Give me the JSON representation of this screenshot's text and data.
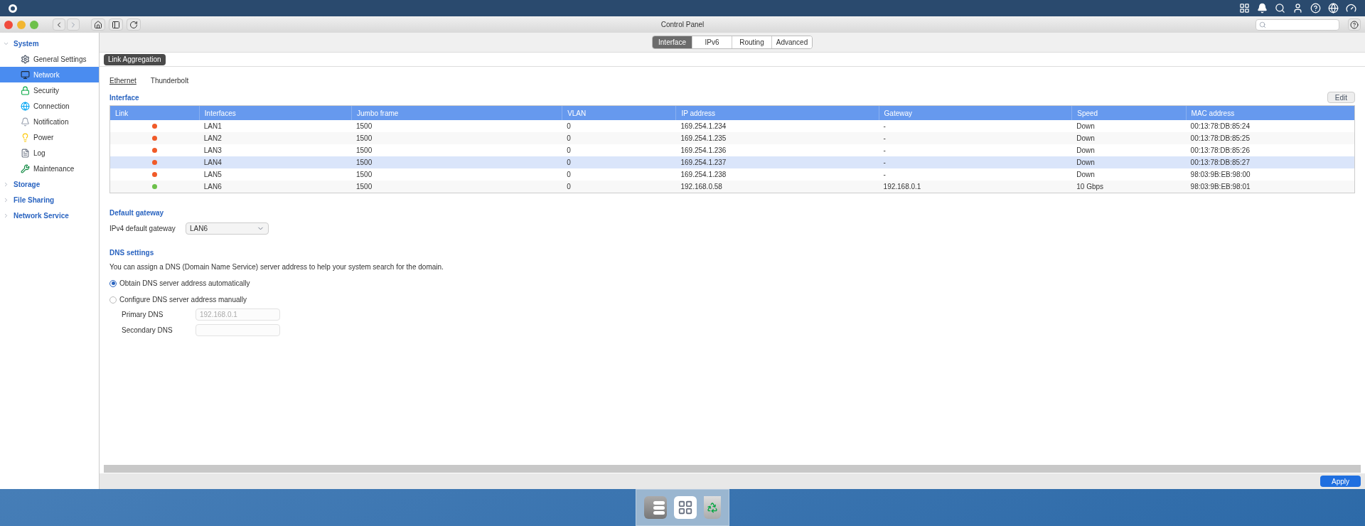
{
  "window": {
    "title": "Control Panel"
  },
  "sidebar": {
    "groups": [
      {
        "label": "System",
        "expanded": true,
        "items": [
          {
            "label": "General Settings",
            "kind": "gear",
            "selected": false
          },
          {
            "label": "Network",
            "kind": "network",
            "selected": true
          },
          {
            "label": "Security",
            "kind": "lock",
            "selected": false
          },
          {
            "label": "Connection",
            "kind": "globe",
            "selected": false
          },
          {
            "label": "Notification",
            "kind": "bell",
            "selected": false
          },
          {
            "label": "Power",
            "kind": "bulb",
            "selected": false
          },
          {
            "label": "Log",
            "kind": "log",
            "selected": false
          },
          {
            "label": "Maintenance",
            "kind": "tools",
            "selected": false
          }
        ]
      },
      {
        "label": "Storage",
        "expanded": false
      },
      {
        "label": "File Sharing",
        "expanded": false
      },
      {
        "label": "Network Service",
        "expanded": false
      }
    ]
  },
  "tabs": [
    {
      "label": "Interface",
      "selected": true
    },
    {
      "label": "IPv6",
      "selected": false
    },
    {
      "label": "Routing",
      "selected": false
    },
    {
      "label": "Advanced",
      "selected": false
    }
  ],
  "link_aggregation_button": "Link Aggregation",
  "subtabs": [
    {
      "label": "Ethernet",
      "selected": true
    },
    {
      "label": "Thunderbolt",
      "selected": false
    }
  ],
  "interface": {
    "title": "Interface",
    "edit_button": "Edit",
    "columns": [
      "Link",
      "Interfaces",
      "Jumbo frame",
      "VLAN",
      "IP address",
      "Gateway",
      "Speed",
      "MAC address"
    ],
    "rows": [
      {
        "color": "#f05a28",
        "cells": [
          "",
          "LAN1",
          "1500",
          "0",
          "169.254.1.234",
          "-",
          "Down",
          "00:13:78:DB:85:24"
        ],
        "selected": false
      },
      {
        "color": "#f05a28",
        "cells": [
          "",
          "LAN2",
          "1500",
          "0",
          "169.254.1.235",
          "-",
          "Down",
          "00:13:78:DB:85:25"
        ],
        "selected": false
      },
      {
        "color": "#f05a28",
        "cells": [
          "",
          "LAN3",
          "1500",
          "0",
          "169.254.1.236",
          "-",
          "Down",
          "00:13:78:DB:85:26"
        ],
        "selected": false
      },
      {
        "color": "#f05a28",
        "cells": [
          "",
          "LAN4",
          "1500",
          "0",
          "169.254.1.237",
          "-",
          "Down",
          "00:13:78:DB:85:27"
        ],
        "selected": true
      },
      {
        "color": "#f05a28",
        "cells": [
          "",
          "LAN5",
          "1500",
          "0",
          "169.254.1.238",
          "-",
          "Down",
          "98:03:9B:EB:98:00"
        ],
        "selected": false
      },
      {
        "color": "#6cc04a",
        "cells": [
          "",
          "LAN6",
          "1500",
          "0",
          "192.168.0.58",
          "192.168.0.1",
          "10 Gbps",
          "98:03:9B:EB:98:01"
        ],
        "selected": false
      }
    ]
  },
  "default_gateway": {
    "title": "Default gateway",
    "label": "IPv4 default gateway",
    "value": "LAN6"
  },
  "dns": {
    "title": "DNS settings",
    "description": "You can assign a DNS (Domain Name Service) server address to help your system search for the domain.",
    "options": [
      {
        "label": "Obtain DNS server address automatically",
        "selected": true
      },
      {
        "label": "Configure DNS server address manually",
        "selected": false
      }
    ],
    "fields": [
      {
        "label": "Primary DNS",
        "value": "192.168.0.1",
        "disabled": true
      },
      {
        "label": "Secondary DNS",
        "disabled": true
      }
    ]
  },
  "apply_button": "Apply"
}
